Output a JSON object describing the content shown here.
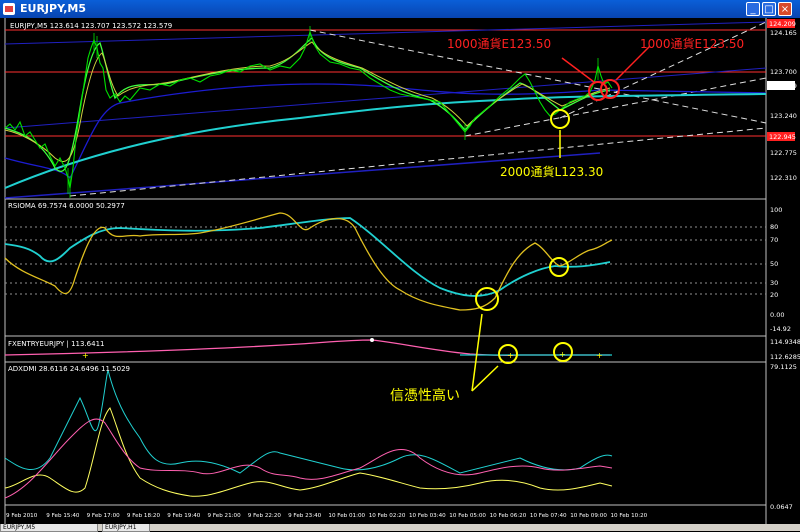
{
  "window": {
    "title": "EURJPY,M5",
    "min": "_",
    "max": "□",
    "close": "×"
  },
  "main": {
    "info": "EURJPY,M5  123.614 123.707 123.572 123.579",
    "prices": [
      "124.165",
      "123.700",
      "123.579",
      "123.240",
      "122.775",
      "122.310"
    ],
    "high_tag": "124.209",
    "low_tag": "122.945",
    "ann_sell1": "1000通貨E123.50",
    "ann_sell2": "1000通貨E123.50",
    "ann_buy": "2000通貨L123.30"
  },
  "rsioma": {
    "info": "RSIOMA 69.7574 6.0000 50.2977",
    "levels": [
      "100",
      "80",
      "70",
      "50",
      "30",
      "20",
      "0.00",
      "-14.92"
    ]
  },
  "fxentry": {
    "info": "FXENTRYEURJPY | 113.6411",
    "levels": [
      "114.9348",
      "112.6285"
    ],
    "note": "信憑性高い"
  },
  "adx": {
    "info": "ADXDMI 28.6116 24.6496 11.5029",
    "levels": [
      "79.1125",
      "0.0647"
    ]
  },
  "time_axis": [
    "9 Feb 2010",
    "9 Feb 15:40",
    "9 Feb 17:00",
    "9 Feb 18:20",
    "9 Feb 19:40",
    "9 Feb 21:00",
    "9 Feb 22:20",
    "9 Feb 23:40",
    "10 Feb 01:00",
    "10 Feb 02:20",
    "10 Feb 03:40",
    "10 Feb 05:00",
    "10 Feb 06:20",
    "10 Feb 07:40",
    "10 Feb 09:00",
    "10 Feb 10:20"
  ],
  "bottom_tabs": [
    "EURJPY,M5",
    "EURJPY,H1"
  ],
  "colors": {
    "accent_red": "#ff2020",
    "yellow": "#ffff00",
    "cyan": "#40e0e0"
  }
}
